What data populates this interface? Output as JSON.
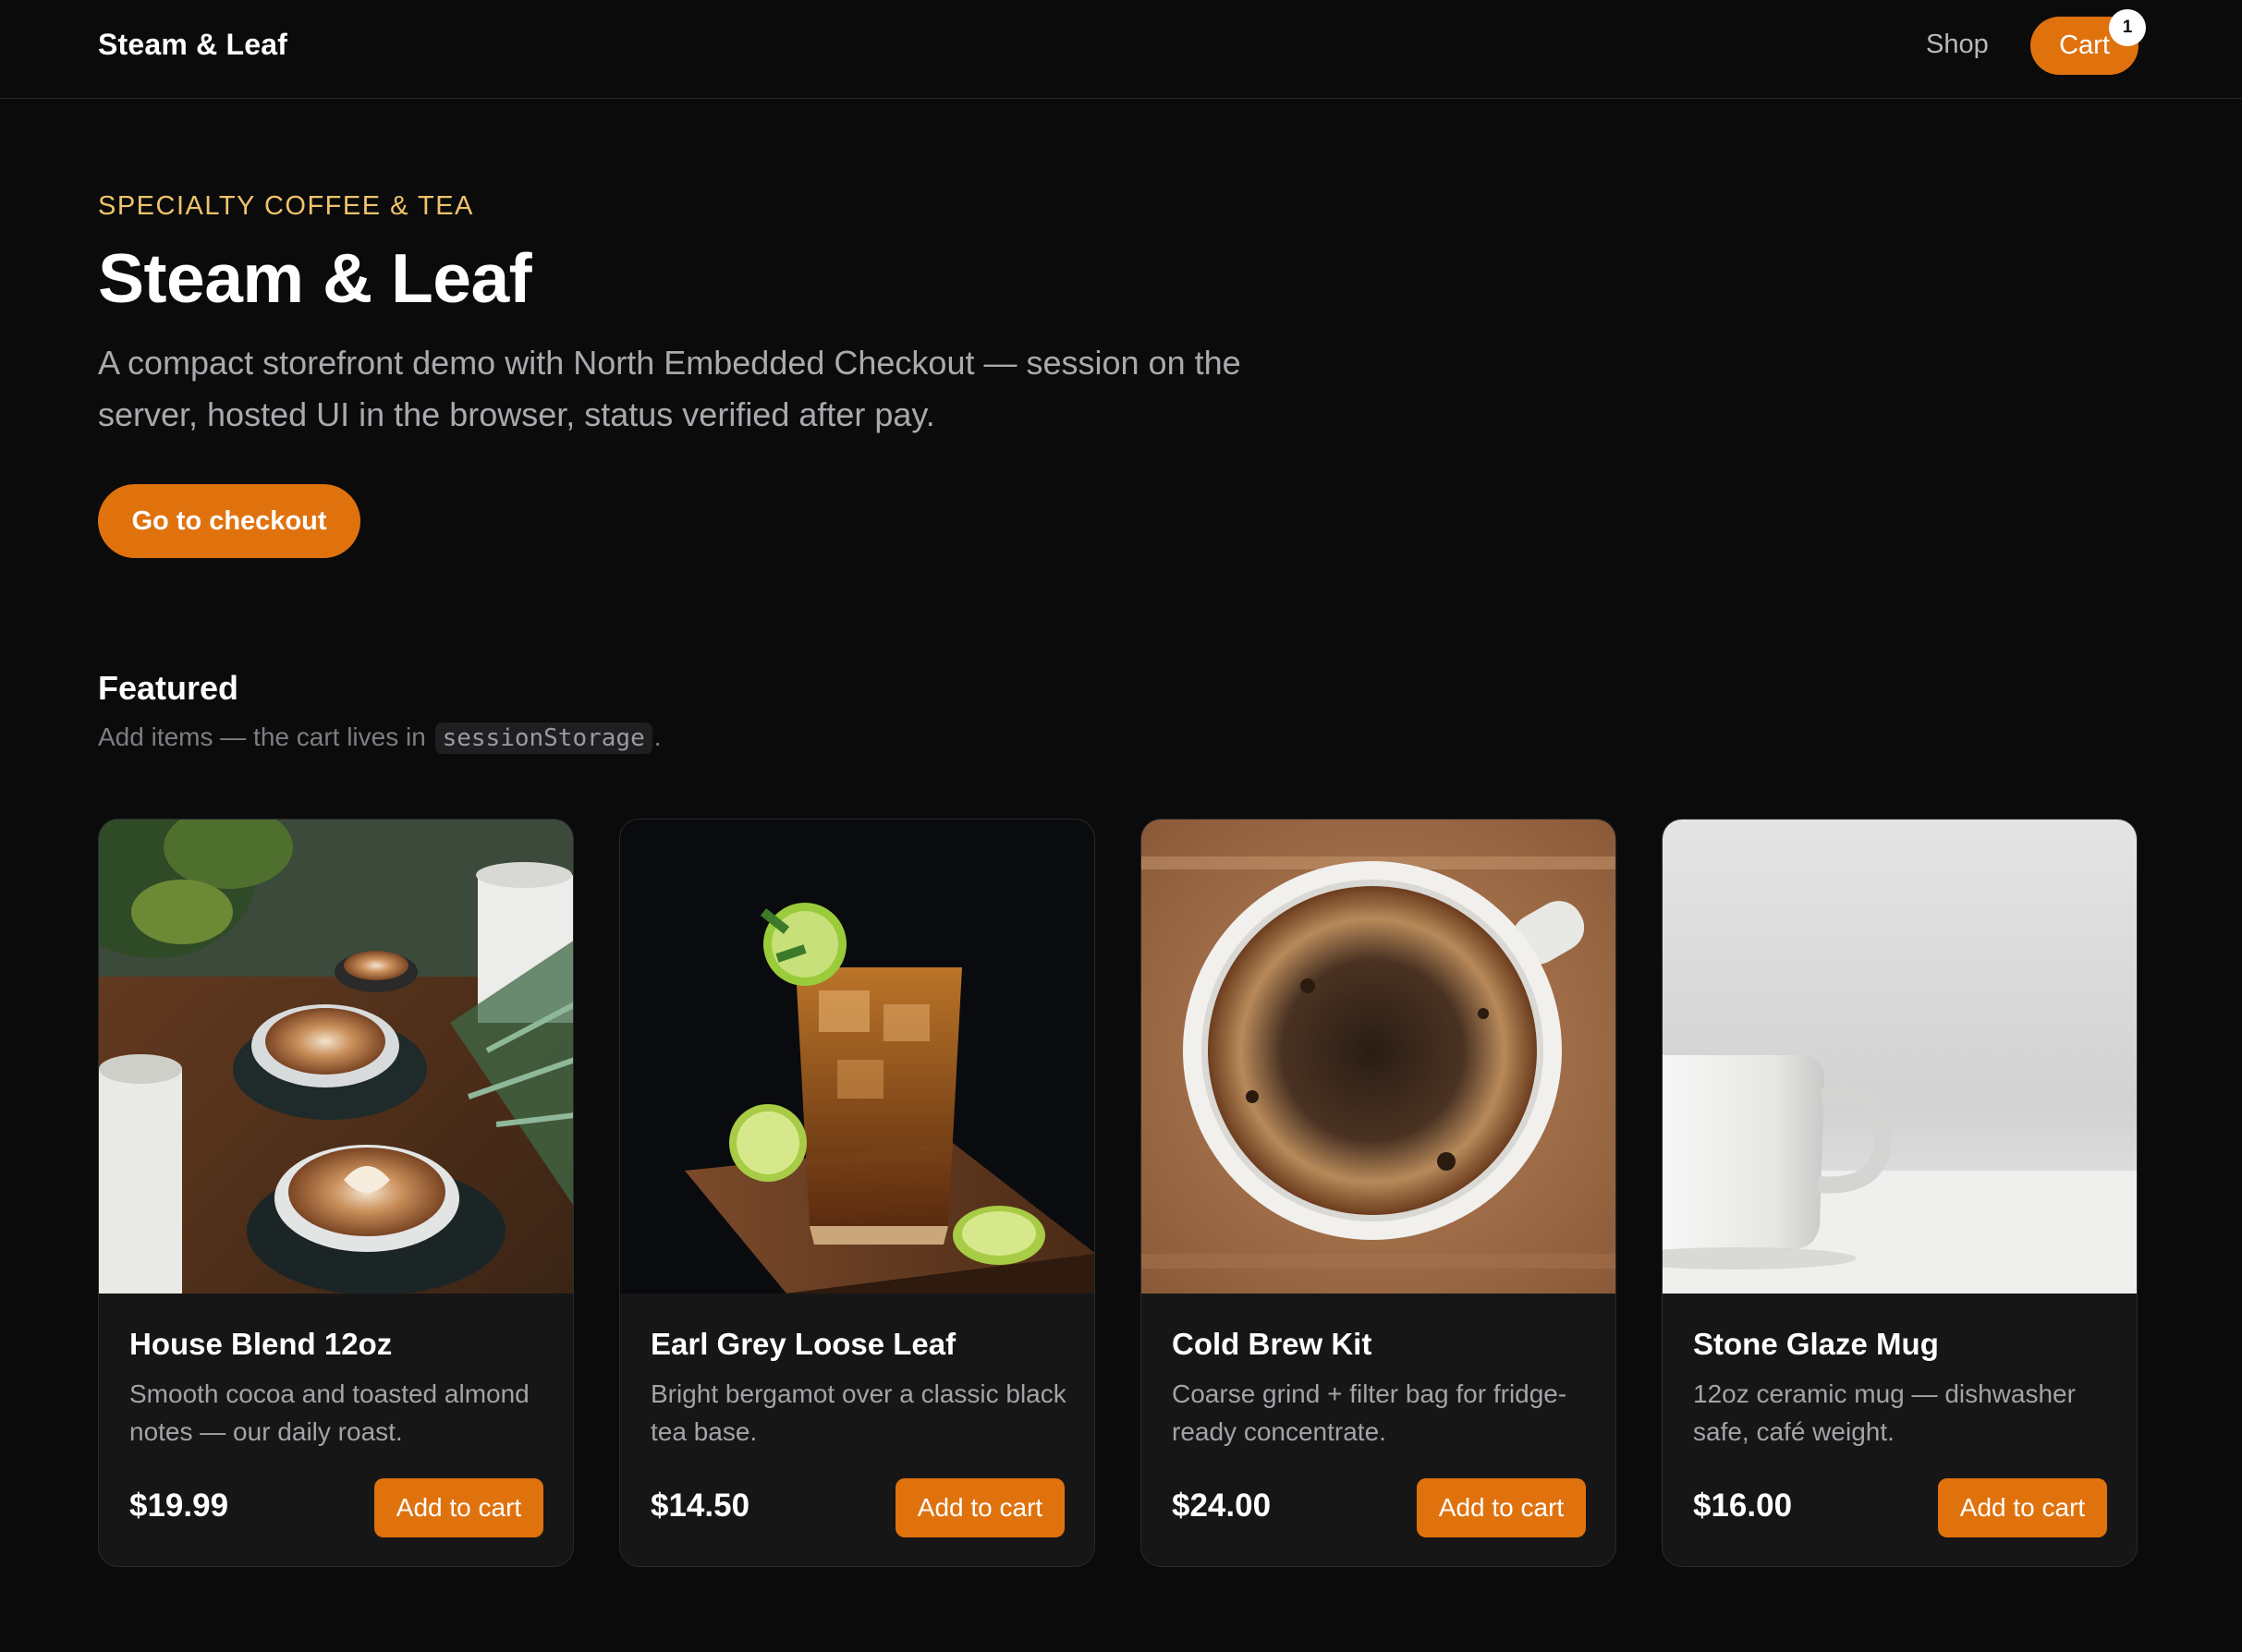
{
  "header": {
    "brand": "Steam & Leaf",
    "nav_shop": "Shop",
    "cart_label": "Cart",
    "cart_count": "1"
  },
  "hero": {
    "eyebrow": "SPECIALTY COFFEE & TEA",
    "title": "Steam & Leaf",
    "description": "A compact storefront demo with North Embedded Checkout — session on the server, hosted UI in the browser, status verified after pay.",
    "cta_label": "Go to checkout"
  },
  "featured": {
    "title": "Featured",
    "subtitle_prefix": "Add items — the cart lives in ",
    "subtitle_code": "sessionStorage",
    "subtitle_suffix": "."
  },
  "products": [
    {
      "name": "House Blend 12oz",
      "description": "Smooth cocoa and toasted almond notes — our daily roast.",
      "price": "$19.99",
      "button": "Add to cart",
      "image": "latte-art-cups-photo"
    },
    {
      "name": "Earl Grey Loose Leaf",
      "description": "Bright bergamot over a classic black tea base.",
      "price": "$14.50",
      "button": "Add to cart",
      "image": "iced-tea-glass-photo"
    },
    {
      "name": "Cold Brew Kit",
      "description": "Coarse grind + filter bag for fridge-ready concentrate.",
      "price": "$24.00",
      "button": "Add to cart",
      "image": "black-coffee-cup-photo"
    },
    {
      "name": "Stone Glaze Mug",
      "description": "12oz ceramic mug — dishwasher safe, café weight.",
      "price": "$16.00",
      "button": "Add to cart",
      "image": "white-mug-photo"
    }
  ],
  "colors": {
    "background": "#0b0b0c",
    "accent": "#e0720e",
    "eyebrow": "#f0c36a",
    "card": "#161617"
  }
}
